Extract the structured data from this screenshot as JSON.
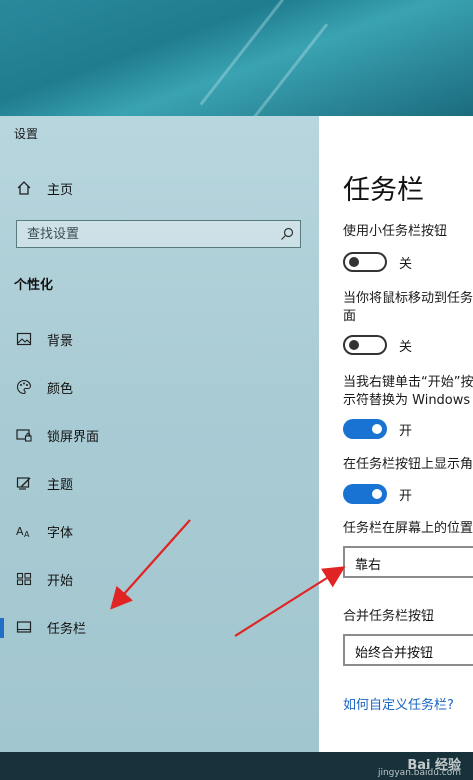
{
  "window": {
    "title": "设置"
  },
  "sidebar": {
    "home_label": "主页",
    "search_placeholder": "查找设置",
    "section_title": "个性化",
    "items": [
      {
        "label": "背景",
        "icon": "image-icon"
      },
      {
        "label": "颜色",
        "icon": "palette-icon"
      },
      {
        "label": "锁屏界面",
        "icon": "lock-screen-icon"
      },
      {
        "label": "主题",
        "icon": "theme-icon"
      },
      {
        "label": "字体",
        "icon": "font-icon"
      },
      {
        "label": "开始",
        "icon": "start-icon"
      },
      {
        "label": "任务栏",
        "icon": "taskbar-icon",
        "selected": true
      }
    ]
  },
  "content": {
    "page_title": "任务栏",
    "settings": {
      "small_buttons_label": "使用小任务栏按钮",
      "small_buttons_state": "关",
      "peek_label_line1": "当你将鼠标移动到任务",
      "peek_label_line2": "面",
      "peek_state": "关",
      "powershell_label_line1": "当我右键单击“开始”按",
      "powershell_label_line2": "示符替换为 Windows",
      "powershell_state": "开",
      "badges_label": "在任务栏按钮上显示角",
      "badges_state": "开",
      "location_label": "任务栏在屏幕上的位置",
      "location_value": "靠右",
      "combine_label": "合并任务栏按钮",
      "combine_value": "始终合并按钮"
    },
    "help_link": "如何自定义任务栏?"
  },
  "watermark": {
    "text": "Bai 经验",
    "sub": "jingyan.baidu.com"
  },
  "colors": {
    "accent": "#1873d3",
    "arrow": "#e02424",
    "link": "#1a66c2"
  }
}
